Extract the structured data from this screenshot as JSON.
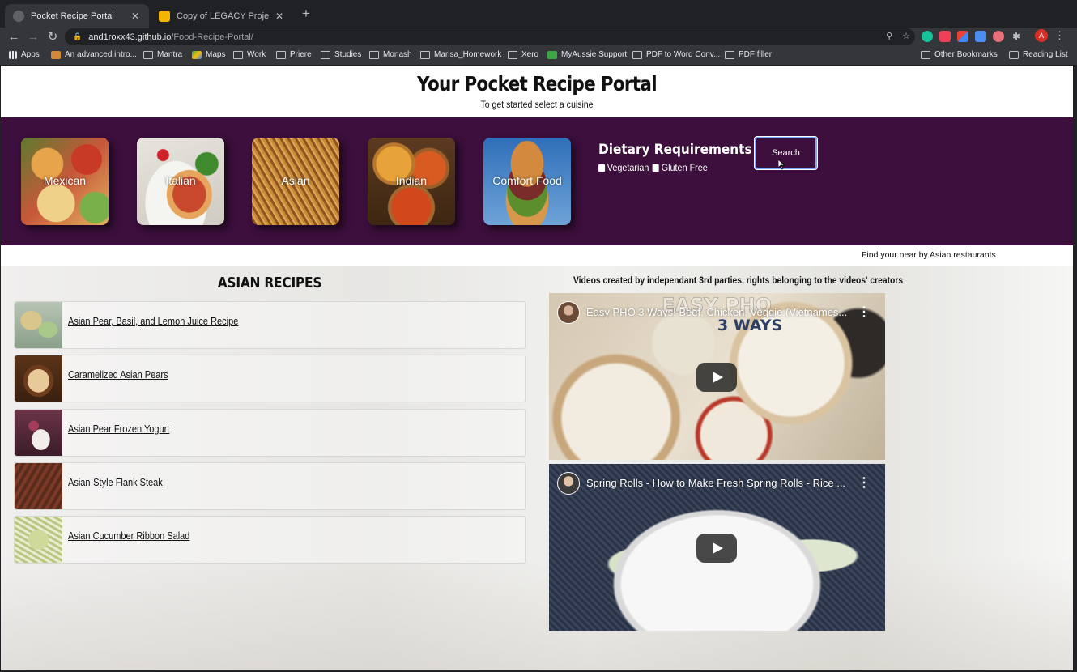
{
  "browser": {
    "tabs": [
      {
        "title": "Pocket Recipe Portal",
        "active": true
      },
      {
        "title": "Copy of LEGACY Project Prese",
        "active": false
      }
    ],
    "url_host": "and1roxx43.github.io",
    "url_path": "/Food-Recipe-Portal/",
    "profile_initial": "A",
    "bookmarks": [
      "Apps",
      "An advanced intro...",
      "Mantra",
      "Maps",
      "Work",
      "Priere",
      "Studies",
      "Monash",
      "Marisa_Homework",
      "Xero",
      "MyAussie Support",
      "PDF to Word Conv...",
      "PDF filler"
    ],
    "other_bookmarks": "Other Bookmarks",
    "reading_list": "Reading List"
  },
  "header": {
    "title": "Your Pocket Recipe Portal",
    "subtitle": "To get started select a cuisine"
  },
  "cuisines": [
    "Mexican",
    "Italian",
    "Asian",
    "Indian",
    "Comfort Food"
  ],
  "dietary": {
    "title": "Dietary Requirements",
    "options": [
      "Vegetarian",
      "Gluten Free"
    ],
    "search_label": "Search"
  },
  "find_restaurants": "Find your near by Asian restaurants",
  "recipes": {
    "title": "ASIAN RECIPES",
    "items": [
      "Asian Pear, Basil, and Lemon Juice Recipe",
      "Caramelized Asian Pears",
      "Asian Pear Frozen Yogurt",
      "Asian-Style Flank Steak",
      "Asian Cucumber Ribbon Salad"
    ]
  },
  "videos": {
    "caption": "Videos created by independant 3rd parties, rights belonging to the videos' creators",
    "items": [
      {
        "title": "Easy PHO 3 Ways! Beef, Chicken, Veggie (Vietnames...",
        "overlay_top": "EASY PHO",
        "overlay_sub": "3 WAYS"
      },
      {
        "title": "Spring Rolls - How to Make Fresh Spring Rolls - Rice ..."
      }
    ]
  }
}
